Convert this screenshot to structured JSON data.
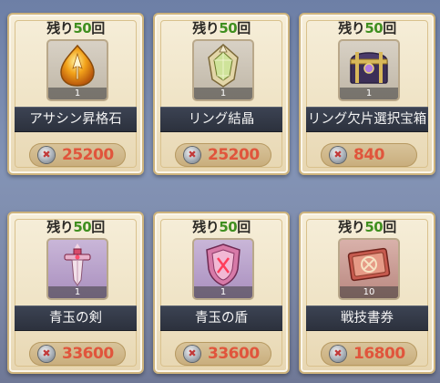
{
  "remain_prefix": "残り",
  "remain_suffix": "回",
  "items": [
    {
      "remaining": "50",
      "qty": "1",
      "name": "アサシン昇格石",
      "price": "25200",
      "icon": "assassin-promotion-stone-icon"
    },
    {
      "remaining": "50",
      "qty": "1",
      "name": "リング結晶",
      "price": "25200",
      "icon": "ring-crystal-icon"
    },
    {
      "remaining": "50",
      "qty": "1",
      "name": "リング欠片選択宝箱",
      "price": "840",
      "icon": "treasure-chest-icon"
    },
    {
      "remaining": "50",
      "qty": "1",
      "name": "青玉の剣",
      "price": "33600",
      "icon": "sapphire-sword-icon"
    },
    {
      "remaining": "50",
      "qty": "1",
      "name": "青玉の盾",
      "price": "33600",
      "icon": "sapphire-shield-icon"
    },
    {
      "remaining": "50",
      "qty": "10",
      "name": "戦技書券",
      "price": "16800",
      "icon": "battle-skill-ticket-icon"
    }
  ],
  "colors": {
    "remaining_number": "#3f8f20",
    "price": "#e0553c",
    "name_bar": "#343a47"
  },
  "currency_icon": "silver-coin-icon"
}
